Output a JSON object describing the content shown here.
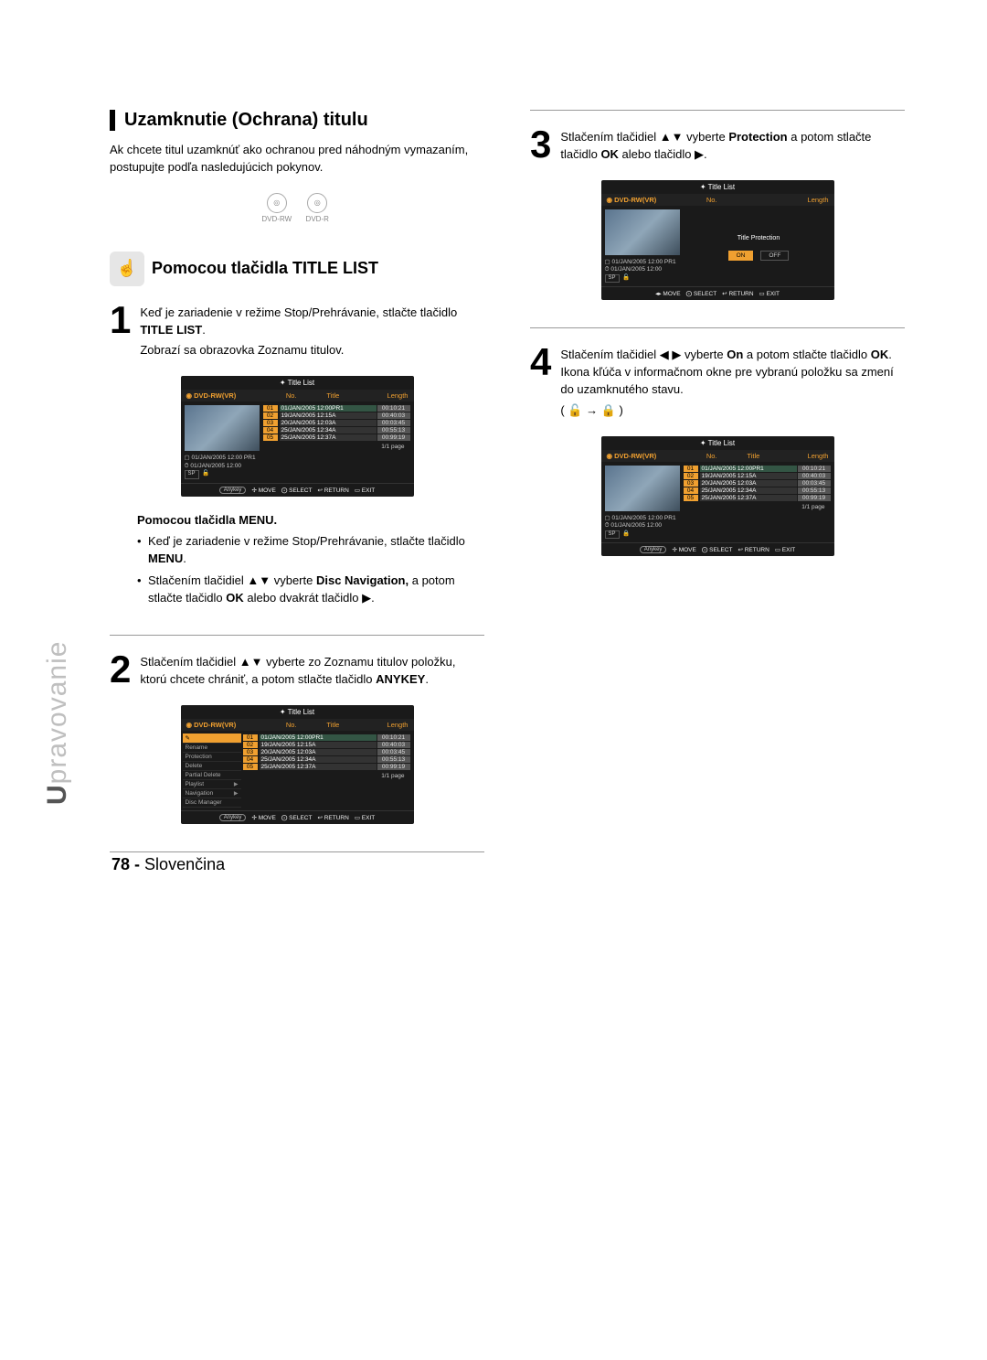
{
  "section_title": "Uzamknutie (Ochrana) titulu",
  "intro": "Ak chcete titul uzamknúť ako ochranou pred náhodným vymazaním, postupujte podľa nasledujúcich pokynov.",
  "disc_badges": [
    "DVD-RW",
    "DVD-R"
  ],
  "sub_heading": "Pomocou tlačidla TITLE LIST",
  "steps": {
    "1": {
      "p1_a": "Keď je zariadenie v režime Stop/Prehrávanie, stlačte tlačidlo ",
      "p1_b": "TITLE LIST",
      "p1_c": ".",
      "p2": "Zobrazí sa obrazovka Zoznamu titulov."
    },
    "menu_heading": "Pomocou tlačidla MENU.",
    "menu_b1_a": "Keď je zariadenie v režime Stop/Prehrávanie, stlačte tlačidlo ",
    "menu_b1_b": "MENU",
    "menu_b1_c": ".",
    "menu_b2_a": "Stlačením tlačidiel ▲▼ vyberte ",
    "menu_b2_b": "Disc Navigation,",
    "menu_b2_c": " a potom stlačte tlačidlo ",
    "menu_b2_d": "OK",
    "menu_b2_e": " alebo dvakrát tlačidlo ▶.",
    "2": {
      "a": "Stlačením tlačidiel ▲▼ vyberte zo Zoznamu titulov položku, ktorú chcete chrániť, a potom stlačte tlačidlo ",
      "b": "ANYKEY",
      "c": "."
    },
    "3": {
      "a": "Stlačením tlačidiel ▲▼ vyberte ",
      "b": "Protection",
      "c": " a potom stlačte tlačidlo ",
      "d": "OK",
      "e": " alebo tlačidlo ▶."
    },
    "4": {
      "a": "Stlačením tlačidiel ◀ ▶ vyberte ",
      "b": "On",
      "c": " a potom stlačte tlačidlo ",
      "d": "OK",
      "e": ". Ikona kľúča v informačnom okne pre vybranú položku sa zmení do uzamknutého stavu.",
      "f": "( 🔓 → 🔒 )"
    }
  },
  "shot_common": {
    "header": "Title List",
    "disc_label": "DVD-RW(VR)",
    "col_no": "No.",
    "col_title": "Title",
    "col_length": "Length",
    "meta_line1": "01/JAN/2005 12:00 PR1",
    "meta_line2": "01/JAN/2005 12:00",
    "meta_sp": "SP",
    "pager": "1/1 page",
    "footer": {
      "anykey": "Anykey",
      "move": "MOVE",
      "select": "SELECT",
      "return": "RETURN",
      "exit": "EXIT"
    },
    "rows": [
      {
        "no": "01",
        "title": "01/JAN/2005 12:00PR1",
        "len": "00:10:21"
      },
      {
        "no": "02",
        "title": "19/JAN/2005 12:15A",
        "len": "00:40:03"
      },
      {
        "no": "03",
        "title": "20/JAN/2005 12:03A",
        "len": "00:03:45"
      },
      {
        "no": "04",
        "title": "25/JAN/2005 12:34A",
        "len": "00:55:13"
      },
      {
        "no": "05",
        "title": "25/JAN/2005 12:37A",
        "len": "00:99:19"
      }
    ]
  },
  "shot_menu": {
    "items": [
      "Rename",
      "Protection",
      "Delete",
      "Partial Delete",
      "Playlist",
      "Navigation",
      "Disc Manager"
    ]
  },
  "shot_protect": {
    "title": "Title Protection",
    "on": "ON",
    "off": "OFF"
  },
  "side_label": {
    "u": "U",
    "rest": "pravovanie"
  },
  "footer": {
    "page": "78 -",
    "lang": "Slovenčina"
  }
}
